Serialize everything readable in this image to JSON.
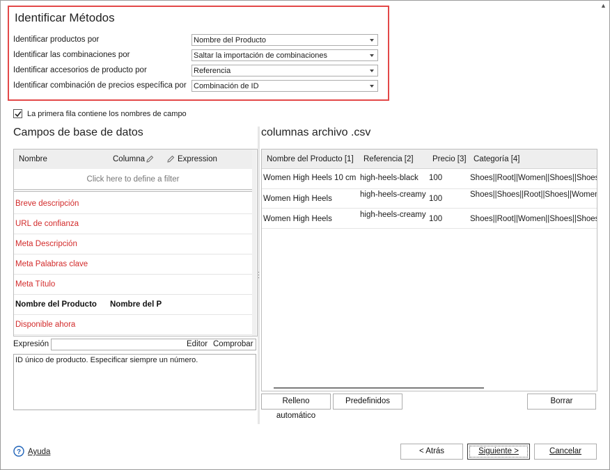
{
  "methods": {
    "title": "Identificar Métodos",
    "rows": [
      {
        "label": "Identificar productos por",
        "value": "Nombre del Producto"
      },
      {
        "label": "Identificar las combinaciones por",
        "value": "Saltar la importación de combinaciones"
      },
      {
        "label": "Identificar accesorios de producto por",
        "value": "Referencia"
      },
      {
        "label": "Identificar combinación de precios específica por",
        "value": "Combinación de ID"
      }
    ]
  },
  "first_row": {
    "label": "La primera fila contiene los nombres de campo",
    "checked": true
  },
  "db_fields": {
    "title": "Campos de base de datos",
    "columns": {
      "name": "Nombre",
      "column": "Columna",
      "expression": "Expression"
    },
    "filter_hint": "Click here to define a filter",
    "rows": [
      {
        "name": "Breve descripción",
        "column": "",
        "style": "red"
      },
      {
        "name": "URL de confianza",
        "column": "",
        "style": "red"
      },
      {
        "name": "Meta Descripción",
        "column": "",
        "style": "red"
      },
      {
        "name": "Meta Palabras clave",
        "column": "",
        "style": "red"
      },
      {
        "name": "Meta Título",
        "column": "",
        "style": "red"
      },
      {
        "name": "Nombre del Producto",
        "column": "Nombre del P",
        "style": "bold"
      },
      {
        "name": "Disponible ahora",
        "column": "",
        "style": "red"
      }
    ]
  },
  "expression": {
    "label": "Expresión",
    "value": "",
    "editor": "Editor",
    "check": "Comprobar",
    "description": "ID único de producto. Especificar siempre un número."
  },
  "csv": {
    "title": "columnas archivo .csv",
    "headers": [
      "Nombre del Producto [1]",
      "Referencia [2]",
      "Precio [3]",
      "Categoría [4]"
    ],
    "rows": [
      [
        "Women High Heels 10 cm",
        "high-heels-black",
        "100",
        "Shoes||Root||Women||Shoes||Shoes"
      ],
      [
        "Women High Heels",
        "high-heels-creamy",
        "100",
        "Shoes||Shoes||Root||Shoes||Women"
      ],
      [
        "Women High Heels",
        "high-heels-creamy",
        "100",
        "Shoes||Root||Women||Shoes||Shoes"
      ]
    ],
    "buttons": {
      "auto_fill": "Relleno automático",
      "presets": "Predefinidos",
      "clear": "Borrar"
    }
  },
  "footer": {
    "help": "Ayuda",
    "back": "< Atrás",
    "next": "Siguiente >",
    "cancel": "Cancelar"
  },
  "icons": {
    "help": "help-circle-icon",
    "pencil": "pencil-icon",
    "check": "checkmark-icon"
  },
  "colors": {
    "highlight_border": "#e34848",
    "required_field": "#d22a2a",
    "help_icon": "#1e62b8"
  }
}
